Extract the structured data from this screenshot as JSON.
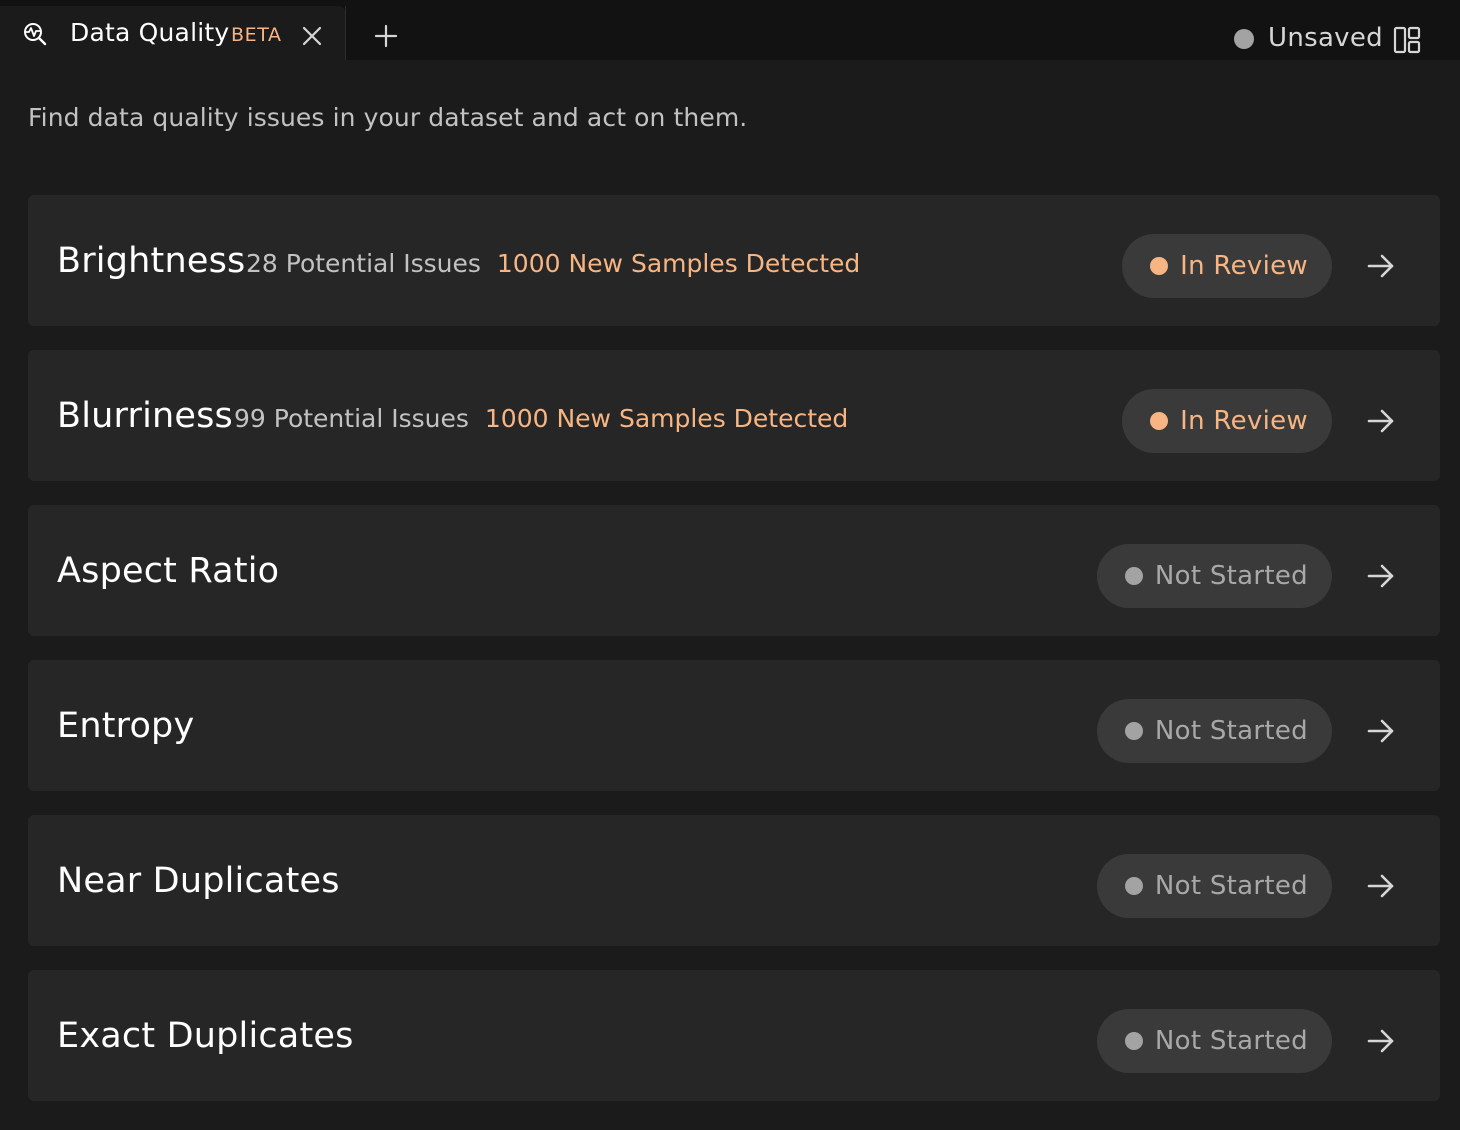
{
  "tab": {
    "title": "Data Quality",
    "badge": "BETA",
    "icon": "data-quality-icon",
    "close_icon": "close-icon",
    "add_icon": "plus-icon"
  },
  "status": {
    "label": "Unsaved",
    "layout_icon": "layout-icon"
  },
  "description": "Find data quality issues in your dataset and act on them.",
  "colors": {
    "accent": "#f7b584",
    "background": "#1b1b1b",
    "card": "#262626",
    "pill": "#3a3a3a",
    "muted": "#a3a3a3"
  },
  "checks": [
    {
      "name": "Brightness",
      "issues": "28 Potential Issues",
      "new_samples": "1000 New Samples Detected",
      "status": "In Review"
    },
    {
      "name": "Blurriness",
      "issues": "99 Potential Issues",
      "new_samples": "1000 New Samples Detected",
      "status": "In Review"
    },
    {
      "name": "Aspect Ratio",
      "status": "Not Started"
    },
    {
      "name": "Entropy",
      "status": "Not Started"
    },
    {
      "name": "Near Duplicates",
      "status": "Not Started"
    },
    {
      "name": "Exact Duplicates",
      "status": "Not Started"
    }
  ]
}
